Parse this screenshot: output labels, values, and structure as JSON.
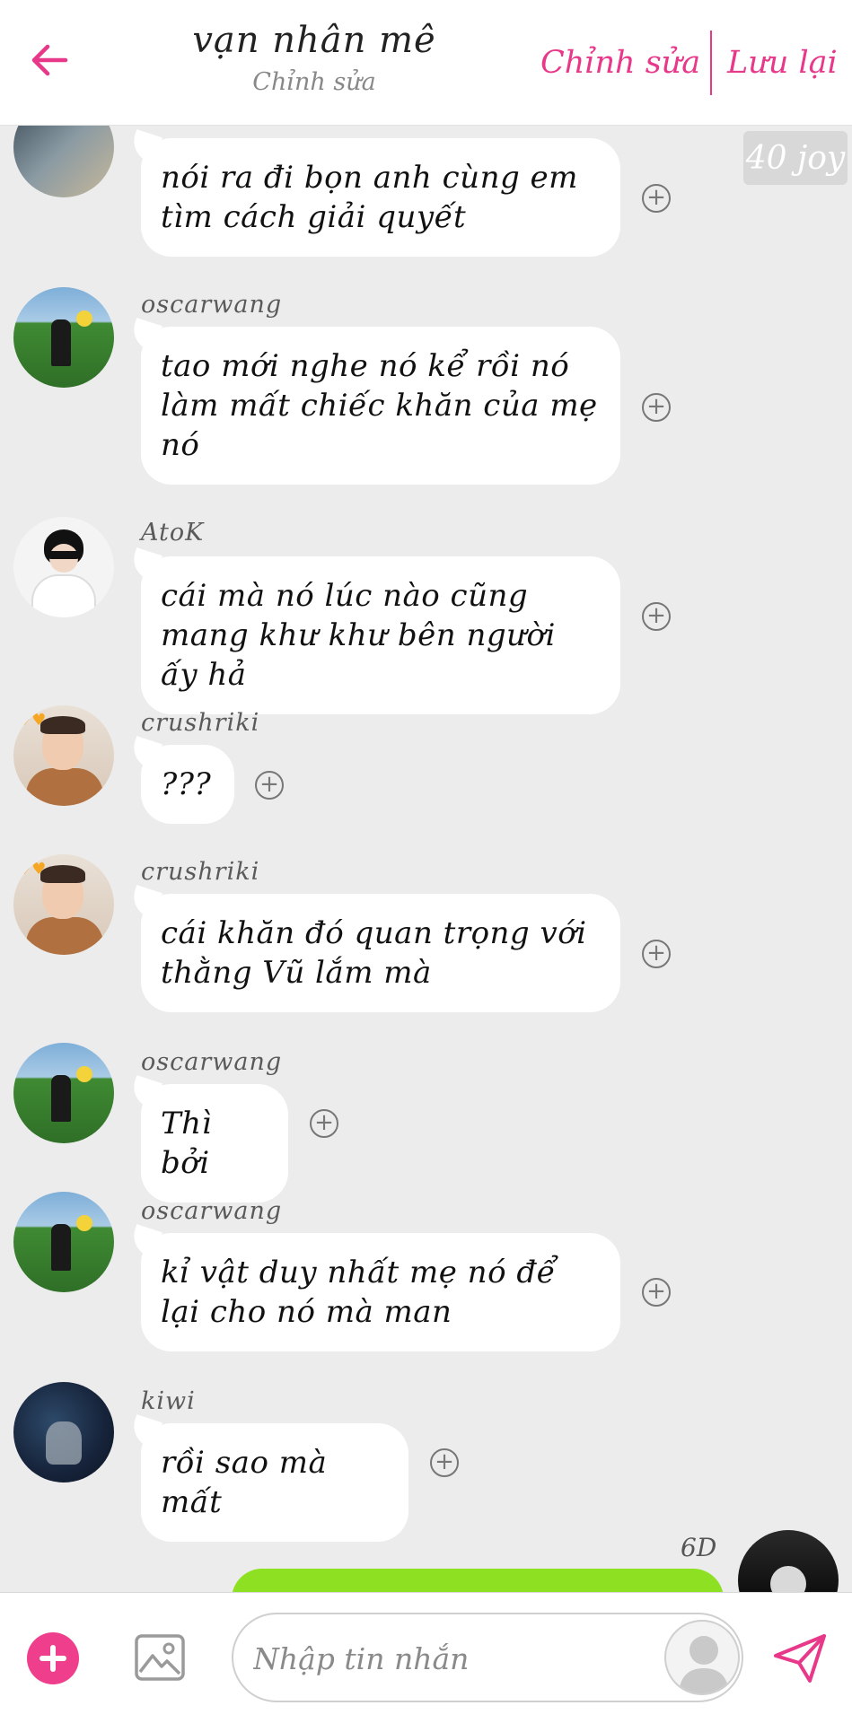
{
  "header": {
    "title": "vạn nhân mê",
    "subtitle": "Chỉnh sửa",
    "edit_label": "Chỉnh sửa",
    "save_label": "Lưu lại"
  },
  "points_badge": "40 joy",
  "messages": [
    {
      "user": "",
      "text": "nói ra đi bọn anh cùng em tìm cách giải quyết"
    },
    {
      "user": "oscarwang",
      "text": "tao mới nghe nó kể rồi nó làm mất chiếc khăn của mẹ nó"
    },
    {
      "user": "AtoK",
      "text": "cái mà nó lúc nào cũng mang khư khư bên người ấy hả"
    },
    {
      "user": "crushriki",
      "text": "???"
    },
    {
      "user": "crushriki",
      "text": "cái khăn đó quan trọng với thằng Vũ lắm mà"
    },
    {
      "user": "oscarwang",
      "text": "Thì bởi"
    },
    {
      "user": "oscarwang",
      "text": "kỉ vật duy nhất mẹ nó để lại cho nó mà man"
    },
    {
      "user": "kiwi",
      "text": "rồi sao mà mất"
    }
  ],
  "my_message": {
    "time": "6D"
  },
  "input": {
    "placeholder": "Nhập tin nhắn"
  },
  "colors": {
    "accent": "#e8388a",
    "plus": "#ef3e8b",
    "my_bubble": "#8ee022",
    "background": "#ececec"
  }
}
